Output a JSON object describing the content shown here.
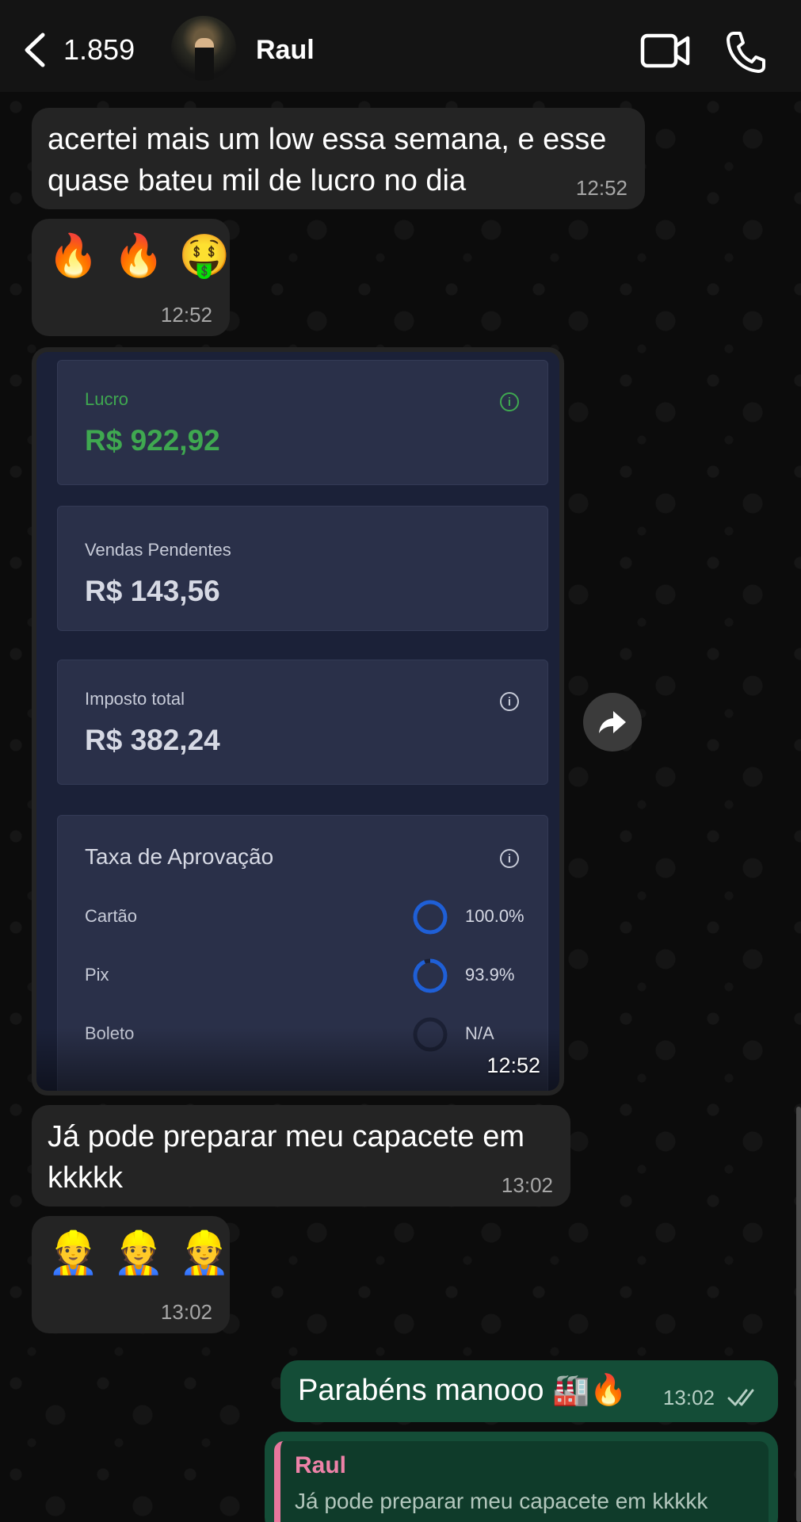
{
  "header": {
    "unread_count": "1.859",
    "contact_name": "Raul",
    "icons": {
      "back": "chevron-left-icon",
      "video": "video-camera-icon",
      "call": "phone-icon"
    }
  },
  "messages": [
    {
      "type": "text",
      "direction": "incoming",
      "text": "acertei mais um low essa semana, e esse quase bateu mil de lucro no dia",
      "time": "12:52"
    },
    {
      "type": "emoji",
      "direction": "incoming",
      "emojis": [
        "🔥",
        "🔥",
        "🤑"
      ],
      "time": "12:52"
    },
    {
      "type": "image",
      "direction": "incoming",
      "time": "12:52",
      "image": {
        "profit": {
          "label": "Lucro",
          "value": "R$ 922,92"
        },
        "pending": {
          "label": "Vendas Pendentes",
          "value": "R$ 143,56"
        },
        "tax": {
          "label": "Imposto total",
          "value": "R$ 382,24"
        },
        "approval": {
          "title": "Taxa de Aprovação",
          "rows": [
            {
              "label": "Cartão",
              "value": "100.0%",
              "fraction": 1.0
            },
            {
              "label": "Pix",
              "value": "93.9%",
              "fraction": 0.939
            },
            {
              "label": "Boleto",
              "value": "N/A",
              "fraction": 0
            }
          ]
        }
      }
    },
    {
      "type": "text",
      "direction": "incoming",
      "text": "Já pode preparar meu capacete em kkkkk",
      "time": "13:02"
    },
    {
      "type": "emoji",
      "direction": "incoming",
      "emojis": [
        "👷",
        "👷",
        "👷"
      ],
      "time": "13:02"
    },
    {
      "type": "text",
      "direction": "outgoing",
      "text": "Parabéns manooo 🏭🔥",
      "time": "13:02",
      "status": "read"
    },
    {
      "type": "reply",
      "direction": "outgoing",
      "quoted_name": "Raul",
      "quoted_text": "Já pode preparar meu capacete em kkkkk"
    }
  ],
  "colors": {
    "incoming_bubble": "#242424",
    "outgoing_bubble": "#144d37",
    "profit_green": "#3fa850",
    "ring_blue": "#1f5fd6",
    "quote_accent": "#e8779d"
  }
}
